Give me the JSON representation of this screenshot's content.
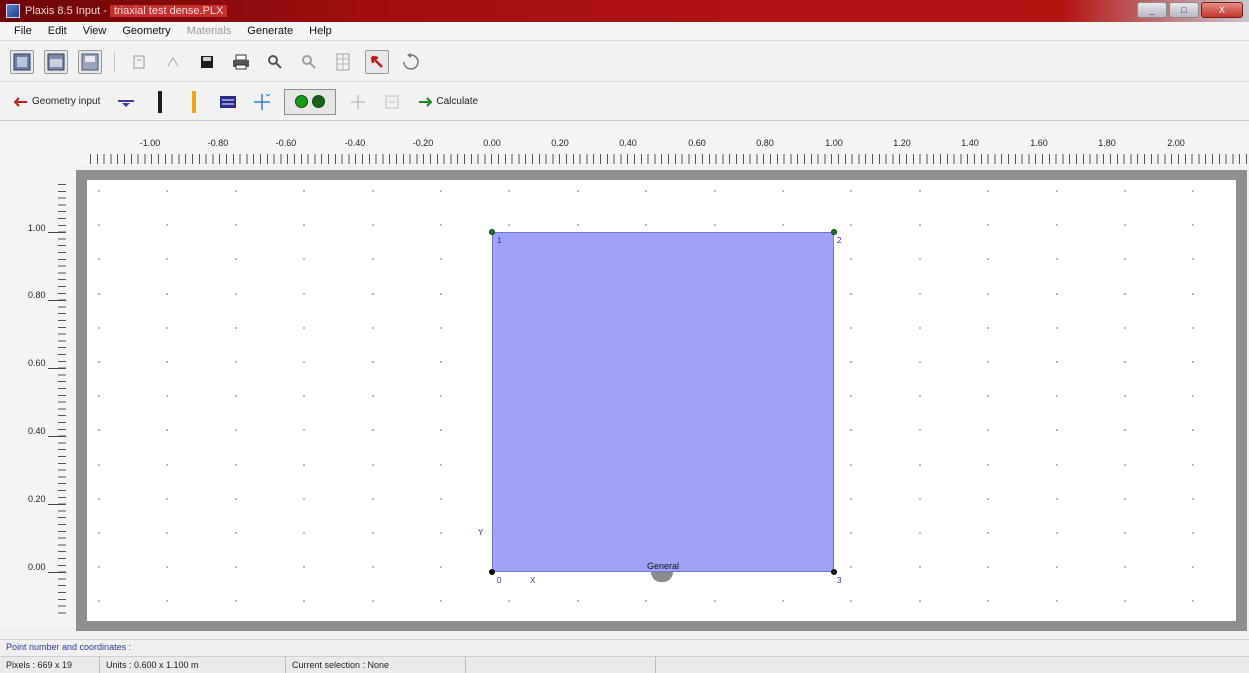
{
  "window": {
    "title": "Plaxis 8.5 Input -",
    "file": "triaxial test dense.PLX",
    "controls": [
      "_",
      "□",
      "X"
    ]
  },
  "menu": {
    "items": [
      {
        "label": "File",
        "enabled": true
      },
      {
        "label": "Edit",
        "enabled": true
      },
      {
        "label": "View",
        "enabled": true
      },
      {
        "label": "Geometry",
        "enabled": true
      },
      {
        "label": "Materials",
        "enabled": false
      },
      {
        "label": "Generate",
        "enabled": true
      },
      {
        "label": "Help",
        "enabled": true
      }
    ]
  },
  "toolbar1": {
    "icons": [
      "new-project-icon",
      "open-project-icon",
      "save-project-icon",
      "undo-icon",
      "redo-icon",
      "save-icon",
      "print-icon",
      "zoom-in-icon",
      "zoom-out-icon",
      "table-icon",
      "selection-icon",
      "rotate-icon"
    ]
  },
  "toolbar2": {
    "geometry_input_label": "Geometry input",
    "calculate_label": "Calculate"
  },
  "rulers": {
    "horizontal": [
      "-1.00",
      "-0.80",
      "-0.60",
      "-0.40",
      "-0.20",
      "0.00",
      "0.20",
      "0.40",
      "0.60",
      "0.80",
      "1.00",
      "1.20",
      "1.40",
      "1.60",
      "1.80",
      "2.00"
    ],
    "vertical": [
      "1.00",
      "0.80",
      "0.60",
      "0.40",
      "0.20",
      "0.00"
    ]
  },
  "geometry": {
    "points": [
      {
        "number": "1",
        "x": 0.0,
        "y": 1.0
      },
      {
        "number": "2",
        "x": 1.0,
        "y": 1.0
      },
      {
        "number": "0",
        "x": 0.0,
        "y": 0.0
      },
      {
        "number": "3",
        "x": 1.0,
        "y": 0.0
      }
    ],
    "axis_y_label": "Y",
    "axis_x_label": "X",
    "boundary_label": "General",
    "cluster_color": "#9fa3f6"
  },
  "status": {
    "point_info": "Point number and coordinates :",
    "pixels": "Pixels : 669 x 19",
    "units": "Units : 0.600 x 1.100 m",
    "selection": "Current selection : None",
    "blank1": "",
    "blank2": ""
  }
}
